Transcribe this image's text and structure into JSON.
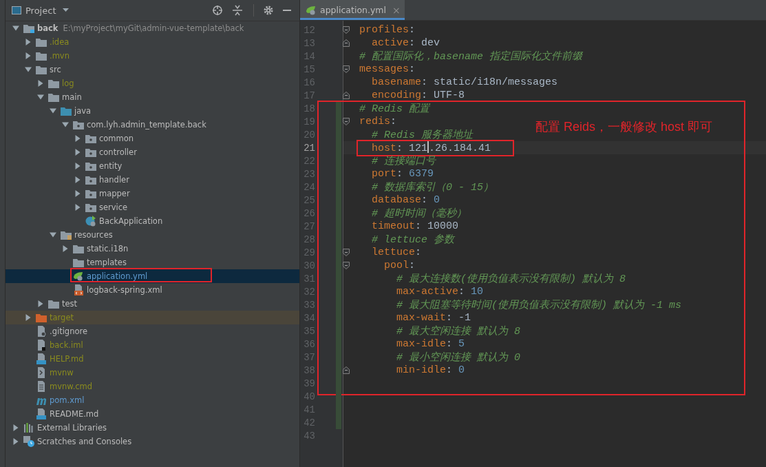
{
  "project_panel": {
    "title": "Project",
    "tree": [
      {
        "name": "back",
        "path": "E:\\myProject\\myGit\\admin-vue-template\\back",
        "kind": "module",
        "color": "#bbbbbb",
        "expanded": true,
        "selected": false,
        "children": [
          {
            "name": ".idea",
            "kind": "folder",
            "color": "#8a8b1e",
            "expanded": false,
            "selected": false
          },
          {
            "name": ".mvn",
            "kind": "folder",
            "color": "#8a8b1e",
            "expanded": false,
            "selected": false
          },
          {
            "name": "src",
            "kind": "folder",
            "color": "#bbbbbb",
            "expanded": true,
            "selected": false,
            "children": [
              {
                "name": "log",
                "kind": "folder",
                "color": "#8a8b1e",
                "expanded": false,
                "selected": false
              },
              {
                "name": "main",
                "kind": "folder",
                "color": "#bbbbbb",
                "expanded": true,
                "selected": false,
                "children": [
                  {
                    "name": "java",
                    "kind": "source-folder",
                    "color": "#bbbbbb",
                    "expanded": true,
                    "selected": false,
                    "children": [
                      {
                        "name": "com.lyh.admin_template.back",
                        "kind": "package",
                        "color": "#bbbbbb",
                        "expanded": true,
                        "selected": false,
                        "children": [
                          {
                            "name": "common",
                            "kind": "package",
                            "color": "#bbbbbb",
                            "expanded": false,
                            "selected": false
                          },
                          {
                            "name": "controller",
                            "kind": "package",
                            "color": "#bbbbbb",
                            "expanded": false,
                            "selected": false
                          },
                          {
                            "name": "entity",
                            "kind": "package",
                            "color": "#bbbbbb",
                            "expanded": false,
                            "selected": false
                          },
                          {
                            "name": "handler",
                            "kind": "package",
                            "color": "#bbbbbb",
                            "expanded": false,
                            "selected": false
                          },
                          {
                            "name": "mapper",
                            "kind": "package",
                            "color": "#bbbbbb",
                            "expanded": false,
                            "selected": false
                          },
                          {
                            "name": "service",
                            "kind": "package",
                            "color": "#bbbbbb",
                            "expanded": false,
                            "selected": false
                          },
                          {
                            "name": "BackApplication",
                            "kind": "spring-class",
                            "color": "#bbbbbb",
                            "selected": false
                          }
                        ]
                      }
                    ]
                  },
                  {
                    "name": "resources",
                    "kind": "resources-folder",
                    "color": "#bbbbbb",
                    "expanded": true,
                    "selected": false,
                    "children": [
                      {
                        "name": "static.i18n",
                        "kind": "folder",
                        "color": "#bbbbbb",
                        "expanded": false,
                        "selected": false
                      },
                      {
                        "name": "templates",
                        "kind": "folder",
                        "color": "#bbbbbb",
                        "selected": false
                      },
                      {
                        "name": "application.yml",
                        "kind": "yml",
                        "color": "#5f9bd0",
                        "selected": true,
                        "annotated": true
                      },
                      {
                        "name": "logback-spring.xml",
                        "kind": "xml",
                        "color": "#bbbbbb",
                        "selected": false
                      }
                    ]
                  }
                ]
              },
              {
                "name": "test",
                "kind": "folder",
                "color": "#bbbbbb",
                "expanded": false,
                "selected": false
              }
            ]
          },
          {
            "name": "target",
            "kind": "excluded-folder",
            "color": "#8a8b1e",
            "expanded": false,
            "selected": false
          },
          {
            "name": ".gitignore",
            "kind": "ignore-file",
            "color": "#bbbbbb",
            "selected": false
          },
          {
            "name": "back.iml",
            "kind": "iml",
            "color": "#8a8b1e",
            "selected": false
          },
          {
            "name": "HELP.md",
            "kind": "md",
            "color": "#8a8b1e",
            "selected": false
          },
          {
            "name": "mvnw",
            "kind": "shell",
            "color": "#8a8b1e",
            "selected": false
          },
          {
            "name": "mvnw.cmd",
            "kind": "text",
            "color": "#8a8b1e",
            "selected": false
          },
          {
            "name": "pom.xml",
            "kind": "maven",
            "color": "#5f9bd0",
            "selected": false
          },
          {
            "name": "README.md",
            "kind": "md",
            "color": "#bbbbbb",
            "selected": false
          }
        ]
      },
      {
        "name": "External Libraries",
        "kind": "libraries",
        "color": "#bbbbbb",
        "expanded": false,
        "selected": false
      },
      {
        "name": "Scratches and Consoles",
        "kind": "scratches",
        "color": "#bbbbbb",
        "expanded": false,
        "selected": false
      }
    ]
  },
  "editor": {
    "tab": {
      "title": "application.yml",
      "close": "×",
      "selected": true
    },
    "blocks": [
      {
        "kind": "plain",
        "lines": [
          {
            "no": "12",
            "fold_start": true,
            "tokens": [
              {
                "kind": "key",
                "text": "profiles"
              },
              {
                "kind": "punct",
                "text": ":"
              }
            ]
          },
          {
            "no": "13",
            "fold_end": true,
            "tokens": [
              {
                "kind": "key",
                "text": "  active"
              },
              {
                "kind": "punct",
                "text": ": "
              },
              {
                "kind": "plain",
                "text": "dev"
              }
            ]
          },
          {
            "no": "14",
            "tokens": [
              {
                "kind": "comment",
                "text": "# 配置国际化，basename 指定国际化文件前缀"
              }
            ]
          },
          {
            "no": "15",
            "fold_start": true,
            "tokens": [
              {
                "kind": "key",
                "text": "messages"
              },
              {
                "kind": "punct",
                "text": ":"
              }
            ]
          },
          {
            "no": "16",
            "tokens": [
              {
                "kind": "key",
                "text": "  basename"
              },
              {
                "kind": "punct",
                "text": ": "
              },
              {
                "kind": "plain",
                "text": "static/i18n/messages"
              }
            ]
          },
          {
            "no": "17",
            "fold_end": true,
            "tokens": [
              {
                "kind": "key",
                "text": "  encoding"
              },
              {
                "kind": "punct",
                "text": ": "
              },
              {
                "kind": "plain",
                "text": "UTF-8"
              }
            ]
          }
        ]
      },
      {
        "kind": "callout",
        "note": "配置 Reids，一般修改 host 即可",
        "lines": [
          {
            "no": "18",
            "changed": true,
            "tokens": [
              {
                "kind": "comment",
                "text": "# Redis 配置"
              }
            ]
          },
          {
            "no": "19",
            "changed": true,
            "fold_start": true,
            "tokens": [
              {
                "kind": "key",
                "text": "redis"
              },
              {
                "kind": "punct",
                "text": ":"
              }
            ]
          },
          {
            "no": "20",
            "changed": true,
            "tokens": [
              {
                "kind": "comment",
                "text": "  # Redis 服务器地址"
              }
            ]
          },
          {
            "no": "21",
            "changed": true,
            "current": true,
            "boxed": true,
            "tokens": [
              {
                "kind": "key",
                "text": "  host"
              },
              {
                "kind": "punct",
                "text": ": "
              },
              {
                "kind": "plain",
                "text": "121",
                "caret": true
              },
              {
                "kind": "plain",
                "text": ".26.184.41"
              }
            ]
          },
          {
            "no": "22",
            "changed": true,
            "tokens": [
              {
                "kind": "comment",
                "text": "  # 连接端口号"
              }
            ]
          },
          {
            "no": "23",
            "changed": true,
            "tokens": [
              {
                "kind": "key",
                "text": "  port"
              },
              {
                "kind": "punct",
                "text": ": "
              },
              {
                "kind": "number",
                "text": "6379"
              }
            ]
          },
          {
            "no": "24",
            "changed": true,
            "tokens": [
              {
                "kind": "comment",
                "text": "  # 数据库索引（0 - 15）"
              }
            ]
          },
          {
            "no": "25",
            "changed": true,
            "tokens": [
              {
                "kind": "key",
                "text": "  database"
              },
              {
                "kind": "punct",
                "text": ": "
              },
              {
                "kind": "number",
                "text": "0"
              }
            ]
          },
          {
            "no": "26",
            "changed": true,
            "tokens": [
              {
                "kind": "comment",
                "text": "  # 超时时间（毫秒）"
              }
            ]
          },
          {
            "no": "27",
            "changed": true,
            "tokens": [
              {
                "kind": "key",
                "text": "  timeout"
              },
              {
                "kind": "punct",
                "text": ": "
              },
              {
                "kind": "plain",
                "text": "10000"
              }
            ]
          },
          {
            "no": "28",
            "changed": true,
            "tokens": [
              {
                "kind": "comment",
                "text": "  # lettuce 参数"
              }
            ]
          },
          {
            "no": "29",
            "changed": true,
            "fold_start": true,
            "tokens": [
              {
                "kind": "key",
                "text": "  lettuce"
              },
              {
                "kind": "punct",
                "text": ":"
              }
            ]
          },
          {
            "no": "30",
            "changed": true,
            "fold_start": true,
            "tokens": [
              {
                "kind": "key",
                "text": "    pool"
              },
              {
                "kind": "punct",
                "text": ":"
              }
            ]
          },
          {
            "no": "31",
            "changed": true,
            "tokens": [
              {
                "kind": "comment",
                "text": "      # 最大连接数(使用负值表示没有限制) 默认为 8"
              }
            ]
          },
          {
            "no": "32",
            "changed": true,
            "tokens": [
              {
                "kind": "key",
                "text": "      max-active"
              },
              {
                "kind": "punct",
                "text": ": "
              },
              {
                "kind": "number",
                "text": "10"
              }
            ]
          },
          {
            "no": "33",
            "changed": true,
            "tokens": [
              {
                "kind": "comment",
                "text": "      # 最大阻塞等待时间(使用负值表示没有限制) 默认为 -1 ms"
              }
            ]
          },
          {
            "no": "34",
            "changed": true,
            "tokens": [
              {
                "kind": "key",
                "text": "      max-wait"
              },
              {
                "kind": "punct",
                "text": ": "
              },
              {
                "kind": "plain",
                "text": "-1"
              }
            ]
          },
          {
            "no": "35",
            "changed": true,
            "tokens": [
              {
                "kind": "comment",
                "text": "      # 最大空闲连接 默认为 8"
              }
            ]
          },
          {
            "no": "36",
            "changed": true,
            "tokens": [
              {
                "kind": "key",
                "text": "      max-idle"
              },
              {
                "kind": "punct",
                "text": ": "
              },
              {
                "kind": "number",
                "text": "5"
              }
            ]
          },
          {
            "no": "37",
            "changed": true,
            "tokens": [
              {
                "kind": "comment",
                "text": "      # 最小空闲连接 默认为 0"
              }
            ]
          },
          {
            "no": "38",
            "changed": true,
            "fold_end": true,
            "tokens": [
              {
                "kind": "key",
                "text": "      min-idle"
              },
              {
                "kind": "punct",
                "text": ": "
              },
              {
                "kind": "number",
                "text": "0"
              }
            ]
          },
          {
            "no": "39",
            "changed": true
          }
        ]
      },
      {
        "kind": "plain",
        "lines": [
          {
            "no": "40",
            "changed": true
          },
          {
            "no": "41",
            "changed": true
          },
          {
            "no": "42",
            "changed": true
          },
          {
            "no": "43"
          }
        ]
      }
    ]
  }
}
